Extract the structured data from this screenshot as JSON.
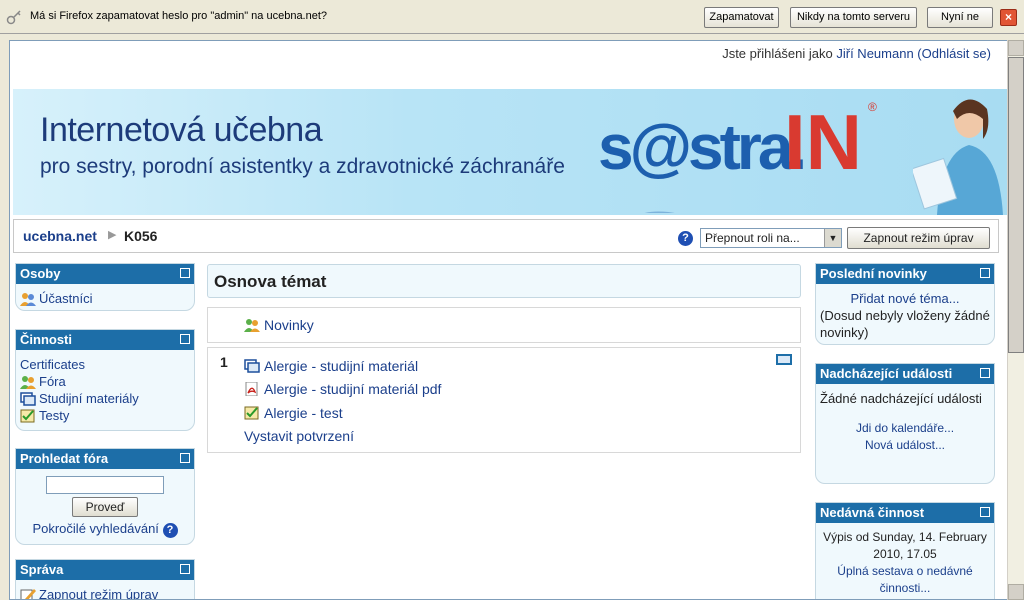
{
  "notification": {
    "message": "Má si Firefox zapamatovat heslo pro \"admin\" na ucebna.net?",
    "remember": "Zapamatovat",
    "never": "Nikdy na tomto serveru",
    "not_now": "Nyní ne",
    "close": "×"
  },
  "header": {
    "login_prefix": "Jste přihlášeni jako ",
    "user": "Jiří Neumann",
    "logout": "(Odhlásit se)"
  },
  "banner": {
    "title": "Internetová učebna",
    "subtitle": "pro sestry, porodní asistentky a zdravotnické záchranáře",
    "logo": "sestraIN",
    "logo_part1": "s@stra.",
    "logo_part2": "IN",
    "registered": "®"
  },
  "nav": {
    "home": "ucebna.net",
    "separator": "▶",
    "course": "K056",
    "help": "?",
    "role_select": "Přepnout roli na...",
    "edit_button": "Zapnout režim úprav"
  },
  "left": {
    "people": {
      "title": "Osoby",
      "items": [
        "Účastníci"
      ]
    },
    "activities": {
      "title": "Činnosti",
      "items": [
        "Certificates",
        "Fóra",
        "Studijní materiály",
        "Testy"
      ]
    },
    "search": {
      "title": "Prohledat fóra",
      "button": "Proveď",
      "advanced": "Pokročilé vyhledávání"
    },
    "admin": {
      "title": "Správa",
      "items": [
        "Zapnout režim úprav"
      ]
    }
  },
  "main": {
    "title": "Osnova témat",
    "news": "Novinky",
    "section_number": "1",
    "items": [
      "Alergie - studijní materiál",
      "Alergie - studijní materiál pdf",
      "Alergie - test"
    ],
    "certificate": "Vystavit potvrzení"
  },
  "right": {
    "news": {
      "title": "Poslední novinky",
      "add": "Přidat nové téma...",
      "none": "(Dosud nebyly vloženy žádné novinky)"
    },
    "events": {
      "title": "Nadcházející události",
      "none": "Žádné nadcházející události",
      "calendar": "Jdi do kalendáře...",
      "new": "Nová událost..."
    },
    "activity": {
      "title": "Nedávná činnost",
      "since": "Výpis od Sunday, 14. February 2010, 17.05",
      "report": "Úplná sestava o nedávné činnosti..."
    }
  },
  "colors": {
    "block_header": "#1d6ea8",
    "link": "#1b3f8b",
    "logo_red": "#d93a30",
    "logo_blue": "#1d5fae"
  }
}
